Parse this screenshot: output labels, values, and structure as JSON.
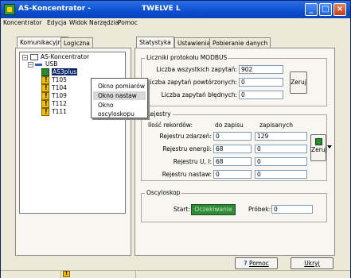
{
  "window": {
    "title": "AS-Koncentrator -",
    "title_extra": "TWELVE L"
  },
  "titlebar_buttons": {
    "minimize": "_",
    "maximize": "□",
    "close": "×"
  },
  "menu": [
    "Koncentrator",
    "Edycja",
    "Widok",
    "Narzędzia",
    "Pomoc"
  ],
  "left_tabs": [
    "Komunikacyjna",
    "Logiczna"
  ],
  "tree": {
    "root": "AS-Koncentrator",
    "usb": "USB",
    "items": [
      "AS3plus",
      "T105",
      "T104",
      "T109",
      "T112",
      "T111"
    ],
    "selected": "AS3plus"
  },
  "context_menu": {
    "items": [
      "Okno pomiarów",
      "Okno nastaw",
      "Okno oscyloskopu"
    ],
    "highlighted": "Okno nastaw"
  },
  "right_tabs": [
    "Statystyka",
    "Ustawienia",
    "Pobieranie danych"
  ],
  "modbus": {
    "title": "Liczniki protokołu MODBUS",
    "rows": [
      {
        "label": "Liczba wszystkich zapytań:",
        "value": "902"
      },
      {
        "label": "Liczba zapytań powtórzonych:",
        "value": "0"
      },
      {
        "label": "Liczba zapytań błędnych:",
        "value": "0"
      }
    ],
    "reset_button": "Zeruj"
  },
  "registers": {
    "title": "Rejestry",
    "col_records": "Ilość rekordów:",
    "col_to_write": "do zapisu",
    "col_written": "zapisanych",
    "rows": [
      {
        "label": "Rejestru zdarzeń:",
        "to_write": "0",
        "written": "129"
      },
      {
        "label": "Rejestru energii:",
        "to_write": "68",
        "written": "0"
      },
      {
        "label": "Rejestru U, I:",
        "to_write": "68",
        "written": "0"
      },
      {
        "label": "Rejestru nastaw:",
        "to_write": "0",
        "written": "0"
      }
    ],
    "reset_button": "Zeruj"
  },
  "oscilloscope": {
    "title": "Oscyloskop",
    "start_label": "Start:",
    "start_value": "Oczekiwanie",
    "samples_label": "Próbek:",
    "samples_value": "0"
  },
  "footer": {
    "help_button": "Pomoc",
    "close_button": "Ukryj"
  },
  "colors": {
    "accent": "#0b4fd0",
    "status_green": "#2e8a34",
    "desktop": "#f2cf5e"
  }
}
